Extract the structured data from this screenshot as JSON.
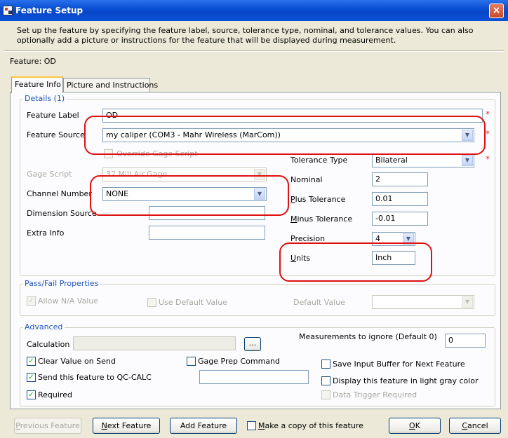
{
  "window": {
    "title": "Feature Setup",
    "close_glyph": "×"
  },
  "description": "Set up the feature by specifying the feature label, source, tolerance type, nominal, and tolerance values. You can also optionally add a picture or instructions for the feature that will be displayed during measurement.",
  "feature_header": "Feature: OD",
  "tabs": [
    {
      "label": "Feature Info",
      "active": true
    },
    {
      "label": "Picture and Instructions",
      "active": false
    }
  ],
  "details": {
    "title": "Details (1)",
    "feature_label": {
      "label": "Feature Label",
      "value": "OD"
    },
    "feature_source": {
      "label": "Feature Source",
      "value": "my caliper (COM3 - Mahr Wireless (MarCom))"
    },
    "override_gage_script": {
      "label": "Override Gage Script",
      "checked": false
    },
    "gage_script": {
      "label": "Gage Script",
      "value": "32 Mill Air Gage"
    },
    "channel_number": {
      "label": "Channel Number",
      "value": "NONE"
    },
    "dimension_source": {
      "label": "Dimension Source",
      "value": ""
    },
    "extra_info": {
      "label": "Extra Info",
      "value": ""
    },
    "tolerance_type": {
      "label": "Tolerance Type",
      "value": "Bilateral"
    },
    "nominal": {
      "label": "Nominal",
      "value": "2"
    },
    "plus_tolerance": {
      "label_u": "P",
      "label_rest": "lus Tolerance",
      "value": "0.01"
    },
    "minus_tolerance": {
      "label_u": "M",
      "label_rest": "inus Tolerance",
      "value": "-0.01"
    },
    "precision": {
      "label": "Precision",
      "value": "4"
    },
    "units": {
      "label_u": "U",
      "label_rest": "nits",
      "value": "Inch"
    },
    "required_marker": "*"
  },
  "pass_fail": {
    "title": "Pass/Fail Properties",
    "allow_na": {
      "label": "Allow N/A Value",
      "checked": true
    },
    "use_default": {
      "label": "Use Default Value",
      "checked": false
    },
    "default_value": {
      "label": "Default Value",
      "value": ""
    }
  },
  "advanced": {
    "title": "Advanced",
    "calculation": {
      "label": "Calculation",
      "value": "",
      "button": "..."
    },
    "clear_value_on_send": {
      "label": "Clear Value on Send",
      "checked": true
    },
    "send_to_qc_calc": {
      "label": "Send this feature to QC-CALC",
      "checked": true,
      "value": ""
    },
    "required": {
      "label": "Required",
      "checked": true
    },
    "gage_prep": {
      "label": "Gage Prep Command",
      "checked": false
    },
    "measurements_to_ignore": {
      "label": "Measurements to ignore (Default 0)",
      "value": "0"
    },
    "save_input_buffer": {
      "label": "Save Input Buffer for Next Feature",
      "checked": false
    },
    "light_gray": {
      "label": "Display this feature in light gray color",
      "checked": false
    },
    "data_trigger_required": {
      "label": "Data Trigger Required",
      "checked": false
    },
    "check_glyph": "✓"
  },
  "footer": {
    "previous": {
      "label_u": "P",
      "label_rest": "revious Feature"
    },
    "next": {
      "label_u": "N",
      "label_rest": "ext Feature"
    },
    "add": {
      "label": "Add Feature"
    },
    "copy": {
      "label_u": "M",
      "label_rest": "ake a copy of this feature",
      "checked": false
    },
    "ok": {
      "label_u": "O",
      "label_rest": "K"
    },
    "cancel": {
      "label_u": "C",
      "label_rest": "ancel"
    }
  },
  "colors": {
    "title_bar": "#0a4fd4",
    "highlight": "#e01010",
    "group_title": "#2356b8",
    "dialog_bg": "#ece9d8"
  }
}
